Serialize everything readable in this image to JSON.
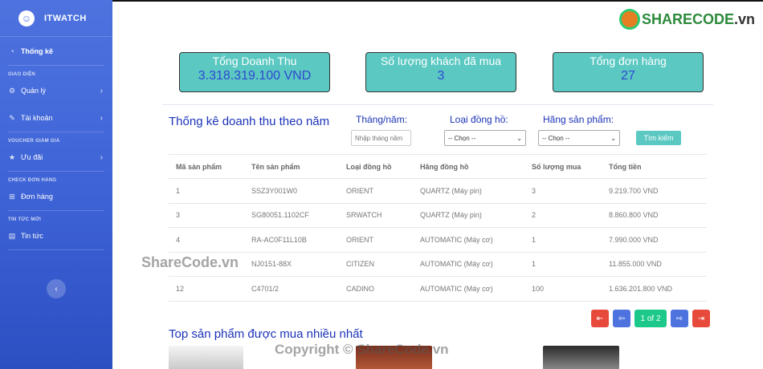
{
  "brand": {
    "name": "ITWATCH",
    "icon": "smile-icon"
  },
  "sidebar": {
    "dashboard": "Thống kê",
    "heading_ui": "GIAO DIỆN",
    "manage": "Quản lý",
    "account": "Tài khoản",
    "heading_voucher": "VOUCHER GIẢM GIÁ",
    "promo": "Ưu đãi",
    "heading_orders": "CHECK ĐƠN HÀNG",
    "orders": "Đơn hàng",
    "heading_news": "TIN TỨC MỚI",
    "news": "Tin tức",
    "toggle": "‹"
  },
  "topbar": {
    "logo_brand": "SHARECODE",
    "logo_suffix": ".vn"
  },
  "stats": [
    {
      "label": "Tổng Doanh Thu",
      "value": "3.318.319.100 VND"
    },
    {
      "label": "Số lượng khách đã mua",
      "value": "3"
    },
    {
      "label": "Tổng đơn hàng",
      "value": "27"
    }
  ],
  "filters": {
    "section_title": "Thống kê doanh thu theo năm",
    "month_label": "Tháng/năm:",
    "month_placeholder": "Nhập tháng năm",
    "type_label": "Loại đồng hồ:",
    "type_value": "-- Chọn --",
    "brand_label": "Hãng sản phẩm:",
    "brand_value": "-- Chọn --",
    "search_button": "Tìm kiếm"
  },
  "table": {
    "headers": [
      "Mã sản phẩm",
      "Tên sản phẩm",
      "Loại đồng hồ",
      "Hãng đồng hồ",
      "Số lượng mua",
      "Tổng tiền"
    ],
    "rows": [
      [
        "1",
        "SSZ3Y001W0",
        "ORIENT",
        "QUARTZ (Máy pin)",
        "3",
        "9.219.700 VND"
      ],
      [
        "3",
        "SG80051.1102CF",
        "SRWATCH",
        "QUARTZ (Máy pin)",
        "2",
        "8.860.800 VND"
      ],
      [
        "4",
        "RA-AC0F11L10B",
        "ORIENT",
        "AUTOMATIC (Máy cơ)",
        "1",
        "7.990.000 VND"
      ],
      [
        "",
        "NJ0151-88X",
        "CITIZEN",
        "AUTOMATIC (Máy cơ)",
        "1",
        "11.855.000 VND"
      ],
      [
        "12",
        "C4701/2",
        "CADINO",
        "AUTOMATIC (Máy cơ)",
        "100",
        "1.636.201.800 VND"
      ]
    ]
  },
  "pagination": {
    "first": "⇤",
    "prev": "⇦",
    "page_info": "1 of 2",
    "next": "⇨",
    "last": "⇥"
  },
  "top_section_title": "Top sản phẩm được mua nhiều nhất",
  "watermarks": {
    "main": "ShareCode.vn",
    "footer": "Copyright © ShareCode.vn"
  }
}
